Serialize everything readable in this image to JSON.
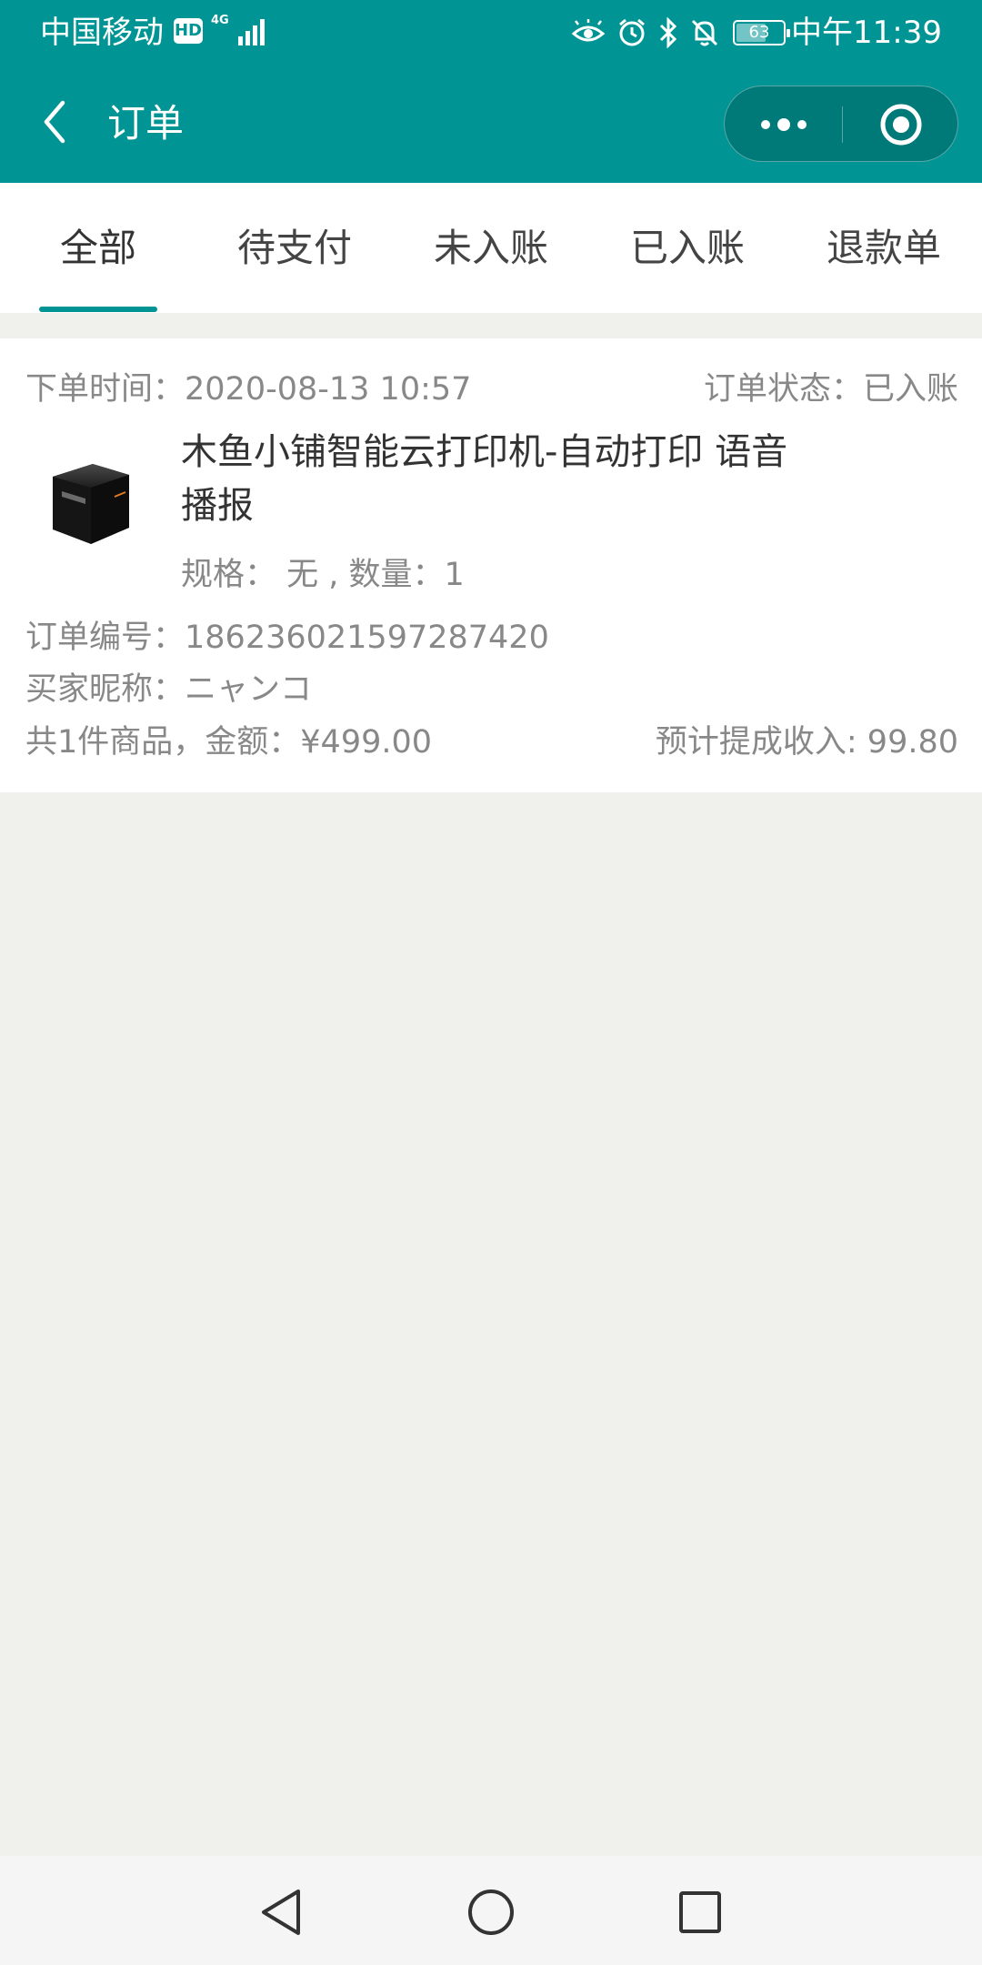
{
  "status_bar": {
    "carrier": "中国移动",
    "hd_badge": "HD",
    "network": "4G",
    "battery_level": "63",
    "battery_fraction": 0.63,
    "time": "中午11:39",
    "icons": [
      "eye-icon",
      "alarm-icon",
      "bluetooth-icon",
      "bell-off-icon"
    ]
  },
  "nav": {
    "title": "订单",
    "back_icon": "back-chevron-icon",
    "more_icon": "more-dots-icon",
    "close_icon": "target-circle-icon"
  },
  "tabs": [
    {
      "label": "全部",
      "active": true
    },
    {
      "label": "待支付",
      "active": false
    },
    {
      "label": "未入账",
      "active": false
    },
    {
      "label": "已入账",
      "active": false
    },
    {
      "label": "退款单",
      "active": false
    }
  ],
  "order": {
    "time_label": "下单时间：",
    "time_value": "2020-08-13 10:57",
    "status_label": "订单状态：",
    "status_value": "已入账",
    "product_name": "木鱼小铺智能云打印机-自动打印 语音播报",
    "spec": "规格： 无 , 数量：1",
    "order_no_label": "订单编号：",
    "order_no": "186236021597287420",
    "buyer_label": "买家昵称：",
    "buyer": "ニャンコ",
    "summary_label": "共1件商品，金额：",
    "amount": "¥499.00",
    "commission_label": "预计提成收入: ",
    "commission": "99.80"
  },
  "colors": {
    "brand": "#009494",
    "page_bg": "#f0f0ec",
    "text_primary": "#333333",
    "text_secondary": "#888888"
  },
  "system_nav": [
    "back-triangle-icon",
    "home-circle-icon",
    "recents-square-icon"
  ]
}
